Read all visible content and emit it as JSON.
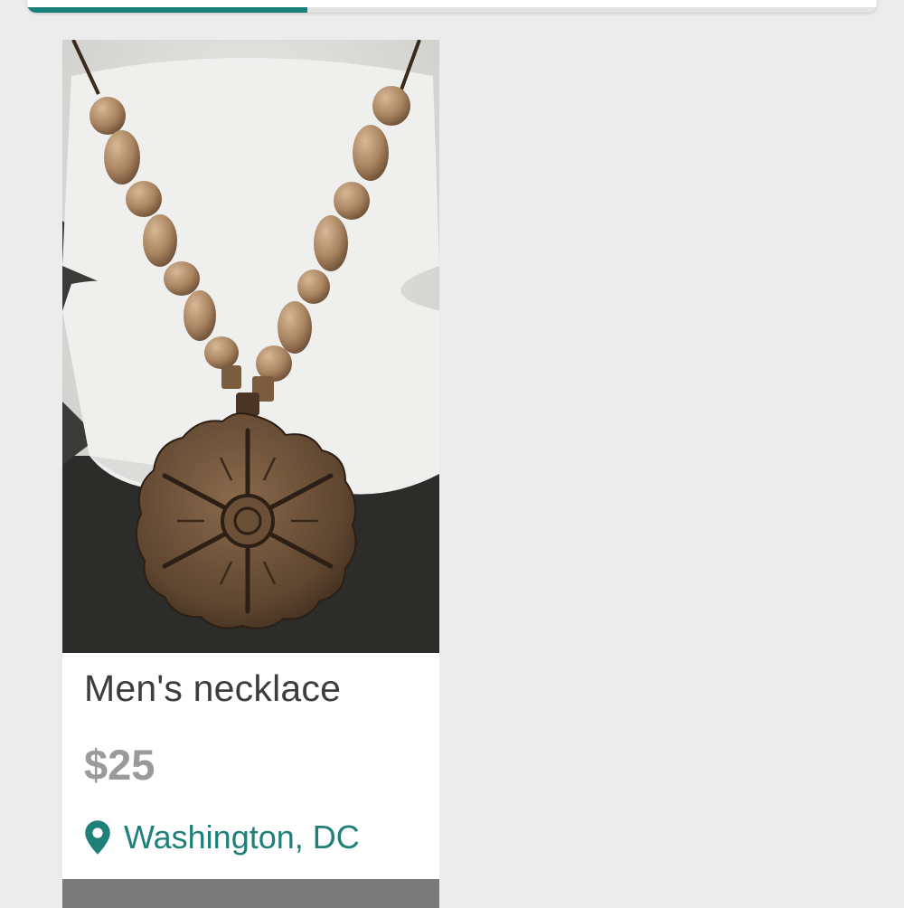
{
  "upload_progress": {
    "fraction": 0.33,
    "color": "#1a7f78"
  },
  "listing": {
    "photo_subject": "wooden bead necklace with carved wooden medallion pendant",
    "title": "Men's necklace",
    "price": "$25",
    "location": "Washington, DC",
    "location_icon": "map-pin-icon",
    "accent_color": "#1f8079"
  }
}
